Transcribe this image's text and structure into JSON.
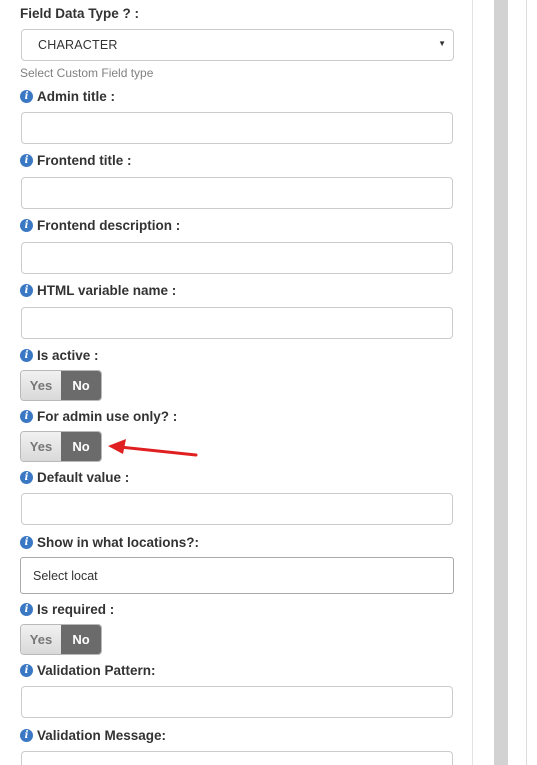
{
  "form": {
    "field_data_type": {
      "label": "Field Data Type ? :",
      "value": "CHARACTER",
      "arrow": "▼",
      "help": "Select Custom Field type"
    },
    "admin_title": {
      "label": "Admin title :",
      "value": ""
    },
    "frontend_title": {
      "label": "Frontend title :",
      "value": ""
    },
    "frontend_description": {
      "label": "Frontend description :",
      "value": ""
    },
    "html_variable_name": {
      "label": "HTML variable name :",
      "value": ""
    },
    "is_active": {
      "label": "Is active :",
      "yes": "Yes",
      "no": "No",
      "selected": "No"
    },
    "admin_use_only": {
      "label": "For admin use only? :",
      "yes": "Yes",
      "no": "No",
      "selected": "No"
    },
    "default_value": {
      "label": "Default value :",
      "value": ""
    },
    "show_locations": {
      "label": "Show in what locations?:",
      "placeholder": "Select locat"
    },
    "is_required": {
      "label": "Is required :",
      "yes": "Yes",
      "no": "No",
      "selected": "No"
    },
    "validation_pattern": {
      "label": "Validation Pattern:",
      "value": ""
    },
    "validation_message": {
      "label": "Validation Message:",
      "value": ""
    }
  },
  "info_icon_glyph": "i",
  "colors": {
    "info_icon": "#3a78c3",
    "toggle_selected": "#6b6b6b",
    "annotation_arrow": "#e02020"
  }
}
